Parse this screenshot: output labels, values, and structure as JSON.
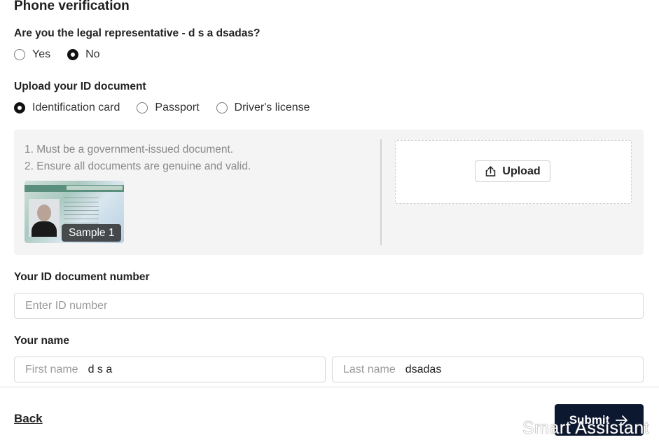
{
  "page": {
    "title": "Phone verification"
  },
  "legal_rep": {
    "question": "Are you the legal representative - d s a dsadas?",
    "options": [
      {
        "label": "Yes",
        "selected": false
      },
      {
        "label": "No",
        "selected": true
      }
    ]
  },
  "id_document": {
    "question": "Upload your ID document",
    "options": [
      {
        "label": "Identification card",
        "selected": true
      },
      {
        "label": "Passport",
        "selected": false
      },
      {
        "label": "Driver's license",
        "selected": false
      }
    ],
    "rules": [
      "1. Must be a government-issued document.",
      "2. Ensure all documents are genuine and valid."
    ],
    "sample_label": "Sample 1",
    "upload_label": "Upload"
  },
  "id_number": {
    "label": "Your ID document number",
    "placeholder": "Enter ID number",
    "value": ""
  },
  "name": {
    "label": "Your name",
    "first_placeholder": "First name",
    "first_value": "d s a",
    "last_placeholder": "Last name",
    "last_value": "dsadas"
  },
  "footer": {
    "back_label": "Back",
    "submit_label": "Submit"
  },
  "watermark": "Smart Assistant",
  "colors": {
    "primary": "#0c1730",
    "panel": "#f4f4f4"
  }
}
